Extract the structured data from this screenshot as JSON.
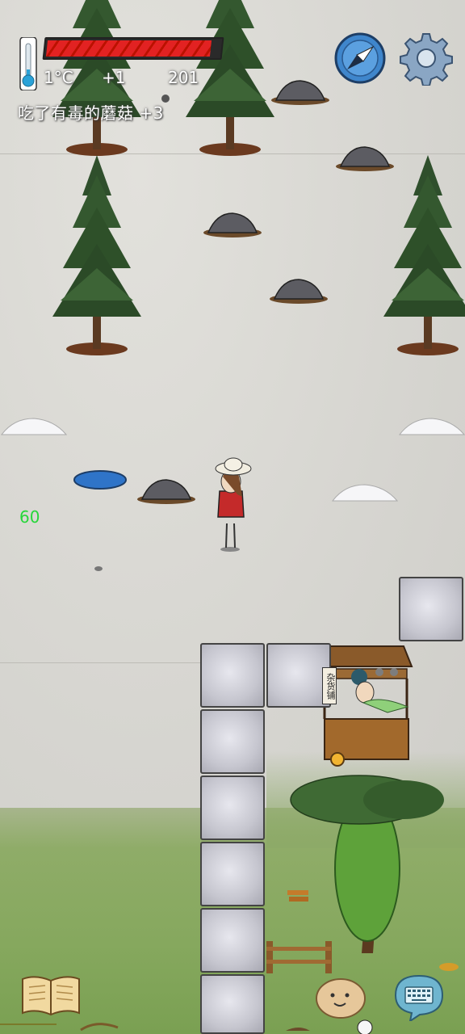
{
  "hud": {
    "temperature": "1°C",
    "temp_delta": "+1",
    "counter": "201",
    "health_fraction": 0.95,
    "message": "吃了有毒的蘑菇 +3",
    "fps": "60"
  },
  "shop": {
    "sign": "杂货铺"
  },
  "icons": {
    "thermometer": "thermometer-icon",
    "compass": "compass-icon",
    "settings": "gear-icon",
    "journal": "book-icon",
    "chat": "keyboard-icon",
    "emote": "face-icon"
  },
  "colors": {
    "health": "#e22222",
    "fps": "#27d63a",
    "grass": "#86a85e",
    "snow": "#d9d8d3"
  }
}
